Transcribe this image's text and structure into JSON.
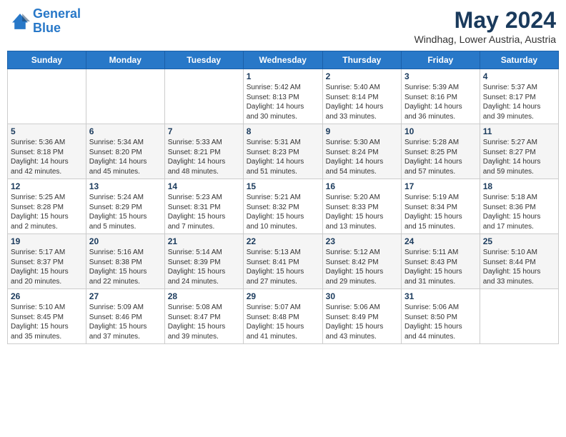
{
  "header": {
    "logo_line1": "General",
    "logo_line2": "Blue",
    "month": "May 2024",
    "location": "Windhag, Lower Austria, Austria"
  },
  "weekdays": [
    "Sunday",
    "Monday",
    "Tuesday",
    "Wednesday",
    "Thursday",
    "Friday",
    "Saturday"
  ],
  "weeks": [
    [
      {
        "day": "",
        "info": ""
      },
      {
        "day": "",
        "info": ""
      },
      {
        "day": "",
        "info": ""
      },
      {
        "day": "1",
        "info": "Sunrise: 5:42 AM\nSunset: 8:13 PM\nDaylight: 14 hours\nand 30 minutes."
      },
      {
        "day": "2",
        "info": "Sunrise: 5:40 AM\nSunset: 8:14 PM\nDaylight: 14 hours\nand 33 minutes."
      },
      {
        "day": "3",
        "info": "Sunrise: 5:39 AM\nSunset: 8:16 PM\nDaylight: 14 hours\nand 36 minutes."
      },
      {
        "day": "4",
        "info": "Sunrise: 5:37 AM\nSunset: 8:17 PM\nDaylight: 14 hours\nand 39 minutes."
      }
    ],
    [
      {
        "day": "5",
        "info": "Sunrise: 5:36 AM\nSunset: 8:18 PM\nDaylight: 14 hours\nand 42 minutes."
      },
      {
        "day": "6",
        "info": "Sunrise: 5:34 AM\nSunset: 8:20 PM\nDaylight: 14 hours\nand 45 minutes."
      },
      {
        "day": "7",
        "info": "Sunrise: 5:33 AM\nSunset: 8:21 PM\nDaylight: 14 hours\nand 48 minutes."
      },
      {
        "day": "8",
        "info": "Sunrise: 5:31 AM\nSunset: 8:23 PM\nDaylight: 14 hours\nand 51 minutes."
      },
      {
        "day": "9",
        "info": "Sunrise: 5:30 AM\nSunset: 8:24 PM\nDaylight: 14 hours\nand 54 minutes."
      },
      {
        "day": "10",
        "info": "Sunrise: 5:28 AM\nSunset: 8:25 PM\nDaylight: 14 hours\nand 57 minutes."
      },
      {
        "day": "11",
        "info": "Sunrise: 5:27 AM\nSunset: 8:27 PM\nDaylight: 14 hours\nand 59 minutes."
      }
    ],
    [
      {
        "day": "12",
        "info": "Sunrise: 5:25 AM\nSunset: 8:28 PM\nDaylight: 15 hours\nand 2 minutes."
      },
      {
        "day": "13",
        "info": "Sunrise: 5:24 AM\nSunset: 8:29 PM\nDaylight: 15 hours\nand 5 minutes."
      },
      {
        "day": "14",
        "info": "Sunrise: 5:23 AM\nSunset: 8:31 PM\nDaylight: 15 hours\nand 7 minutes."
      },
      {
        "day": "15",
        "info": "Sunrise: 5:21 AM\nSunset: 8:32 PM\nDaylight: 15 hours\nand 10 minutes."
      },
      {
        "day": "16",
        "info": "Sunrise: 5:20 AM\nSunset: 8:33 PM\nDaylight: 15 hours\nand 13 minutes."
      },
      {
        "day": "17",
        "info": "Sunrise: 5:19 AM\nSunset: 8:34 PM\nDaylight: 15 hours\nand 15 minutes."
      },
      {
        "day": "18",
        "info": "Sunrise: 5:18 AM\nSunset: 8:36 PM\nDaylight: 15 hours\nand 17 minutes."
      }
    ],
    [
      {
        "day": "19",
        "info": "Sunrise: 5:17 AM\nSunset: 8:37 PM\nDaylight: 15 hours\nand 20 minutes."
      },
      {
        "day": "20",
        "info": "Sunrise: 5:16 AM\nSunset: 8:38 PM\nDaylight: 15 hours\nand 22 minutes."
      },
      {
        "day": "21",
        "info": "Sunrise: 5:14 AM\nSunset: 8:39 PM\nDaylight: 15 hours\nand 24 minutes."
      },
      {
        "day": "22",
        "info": "Sunrise: 5:13 AM\nSunset: 8:41 PM\nDaylight: 15 hours\nand 27 minutes."
      },
      {
        "day": "23",
        "info": "Sunrise: 5:12 AM\nSunset: 8:42 PM\nDaylight: 15 hours\nand 29 minutes."
      },
      {
        "day": "24",
        "info": "Sunrise: 5:11 AM\nSunset: 8:43 PM\nDaylight: 15 hours\nand 31 minutes."
      },
      {
        "day": "25",
        "info": "Sunrise: 5:10 AM\nSunset: 8:44 PM\nDaylight: 15 hours\nand 33 minutes."
      }
    ],
    [
      {
        "day": "26",
        "info": "Sunrise: 5:10 AM\nSunset: 8:45 PM\nDaylight: 15 hours\nand 35 minutes."
      },
      {
        "day": "27",
        "info": "Sunrise: 5:09 AM\nSunset: 8:46 PM\nDaylight: 15 hours\nand 37 minutes."
      },
      {
        "day": "28",
        "info": "Sunrise: 5:08 AM\nSunset: 8:47 PM\nDaylight: 15 hours\nand 39 minutes."
      },
      {
        "day": "29",
        "info": "Sunrise: 5:07 AM\nSunset: 8:48 PM\nDaylight: 15 hours\nand 41 minutes."
      },
      {
        "day": "30",
        "info": "Sunrise: 5:06 AM\nSunset: 8:49 PM\nDaylight: 15 hours\nand 43 minutes."
      },
      {
        "day": "31",
        "info": "Sunrise: 5:06 AM\nSunset: 8:50 PM\nDaylight: 15 hours\nand 44 minutes."
      },
      {
        "day": "",
        "info": ""
      }
    ]
  ]
}
